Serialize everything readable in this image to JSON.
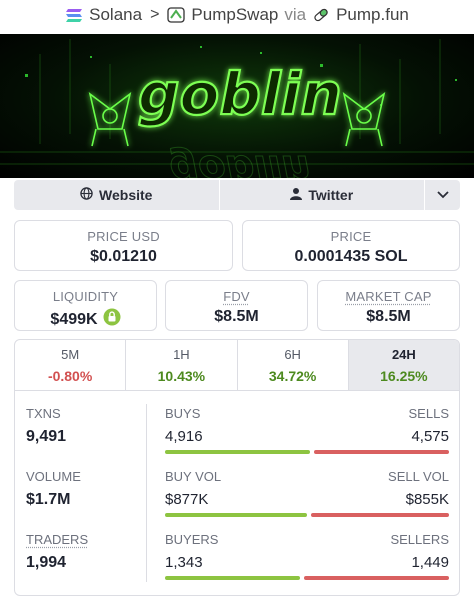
{
  "breadcrumb": {
    "chain": "Solana",
    "dex": "PumpSwap",
    "via": "via",
    "launchpad": "Pump.fun"
  },
  "banner": {
    "title": "goblin"
  },
  "links": {
    "website": "Website",
    "twitter": "Twitter"
  },
  "price_usd": {
    "label": "PRICE USD",
    "value": "$0.01210"
  },
  "price": {
    "label": "PRICE",
    "value": "0.0001435 SOL"
  },
  "liquidity": {
    "label": "LIQUIDITY",
    "value": "$499K"
  },
  "fdv": {
    "label": "FDV",
    "value": "$8.5M"
  },
  "market_cap": {
    "label": "MARKET CAP",
    "value": "$8.5M"
  },
  "timeframes": [
    {
      "label": "5M",
      "change": "-0.80%"
    },
    {
      "label": "1H",
      "change": "10.43%"
    },
    {
      "label": "6H",
      "change": "34.72%"
    },
    {
      "label": "24H",
      "change": "16.25%"
    }
  ],
  "stats": {
    "txns": {
      "label": "TXNS",
      "value": "9,491"
    },
    "volume": {
      "label": "VOLUME",
      "value": "$1.7M"
    },
    "traders": {
      "label": "TRADERS",
      "value": "1,994"
    },
    "buys": {
      "label": "BUYS",
      "value": "4,916"
    },
    "sells": {
      "label": "SELLS",
      "value": "4,575"
    },
    "buy_vol": {
      "label": "BUY VOL",
      "value": "$877K"
    },
    "sell_vol": {
      "label": "SELL VOL",
      "value": "$855K"
    },
    "buyers": {
      "label": "BUYERS",
      "value": "1,343"
    },
    "sellers": {
      "label": "SELLERS",
      "value": "1,449"
    }
  },
  "colors": {
    "positive": "#4d8a1f",
    "negative": "#d25050",
    "buy_bar": "#8dc441",
    "sell_bar": "#d96060"
  }
}
